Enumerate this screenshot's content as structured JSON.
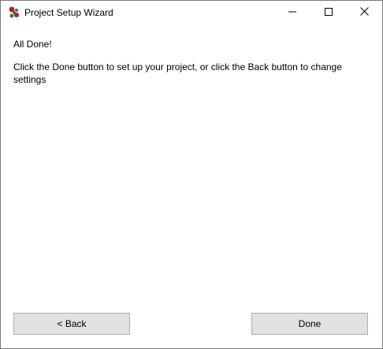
{
  "window": {
    "title": "Project Setup Wizard"
  },
  "content": {
    "heading": "All Done!",
    "message": "Click the Done button to set up your project, or click the Back button to change settings"
  },
  "buttons": {
    "back_label": "< Back",
    "done_label": "Done"
  },
  "icons": {
    "app": "wizard-app-icon",
    "minimize": "minimize-icon",
    "maximize": "maximize-icon",
    "close": "close-icon"
  },
  "colors": {
    "button_face": "#e1e1e1",
    "button_border": "#adadad",
    "window_border": "#7a7a7a"
  }
}
